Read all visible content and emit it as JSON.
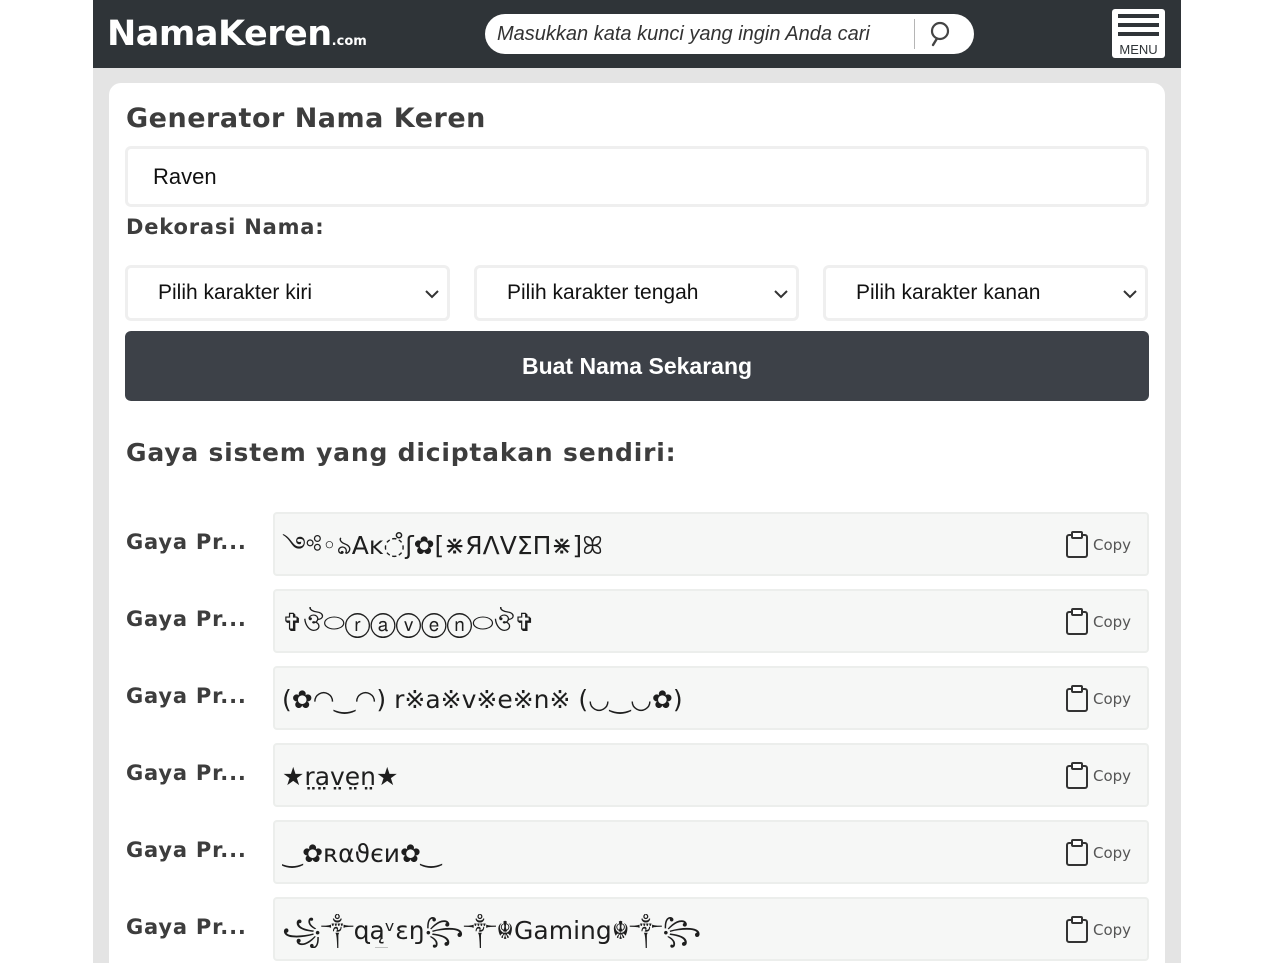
{
  "header": {
    "logo_main": "NamaKeren",
    "logo_suffix": ".com",
    "search_placeholder": "Masukkan kata kunci yang ingin Anda cari",
    "menu_label": "MENU"
  },
  "generator": {
    "title": "Generator Nama Keren",
    "name_value": "Raven",
    "decoration_label": "Dekorasi Nama:",
    "select_left": "Pilih karakter kiri",
    "select_middle": "Pilih karakter tengah",
    "select_right": "Pilih karakter kanan",
    "submit_label": "Buat Nama Sekarang"
  },
  "results": {
    "title": "Gaya sistem yang diciptakan sendiri:",
    "copy_label": "Copy",
    "items": [
      {
        "label": "Gaya Pr...",
        "value": "༺◦ঌAĸ◌̊ʃ✿[⋇ЯΛVΣП⋇]ꕤ"
      },
      {
        "label": "Gaya Pr...",
        "value": "✞ঔ⬭ⓡⓐⓥⓔⓝ⬭ঔ✞"
      },
      {
        "label": "Gaya Pr...",
        "value": "(✿◠‿◠) r※a※v※e※n※ (◡‿◡✿)"
      },
      {
        "label": "Gaya Pr...",
        "value": "★r̤a̤v̤e̤n̤★"
      },
      {
        "label": "Gaya Pr...",
        "value": "‿✿ʀαϑєи✿‿"
      },
      {
        "label": "Gaya Pr...",
        "value": "꧁༒ɋą̲ᵛɛŋ꧂༒☬Gaming☬༒꧂"
      }
    ]
  }
}
